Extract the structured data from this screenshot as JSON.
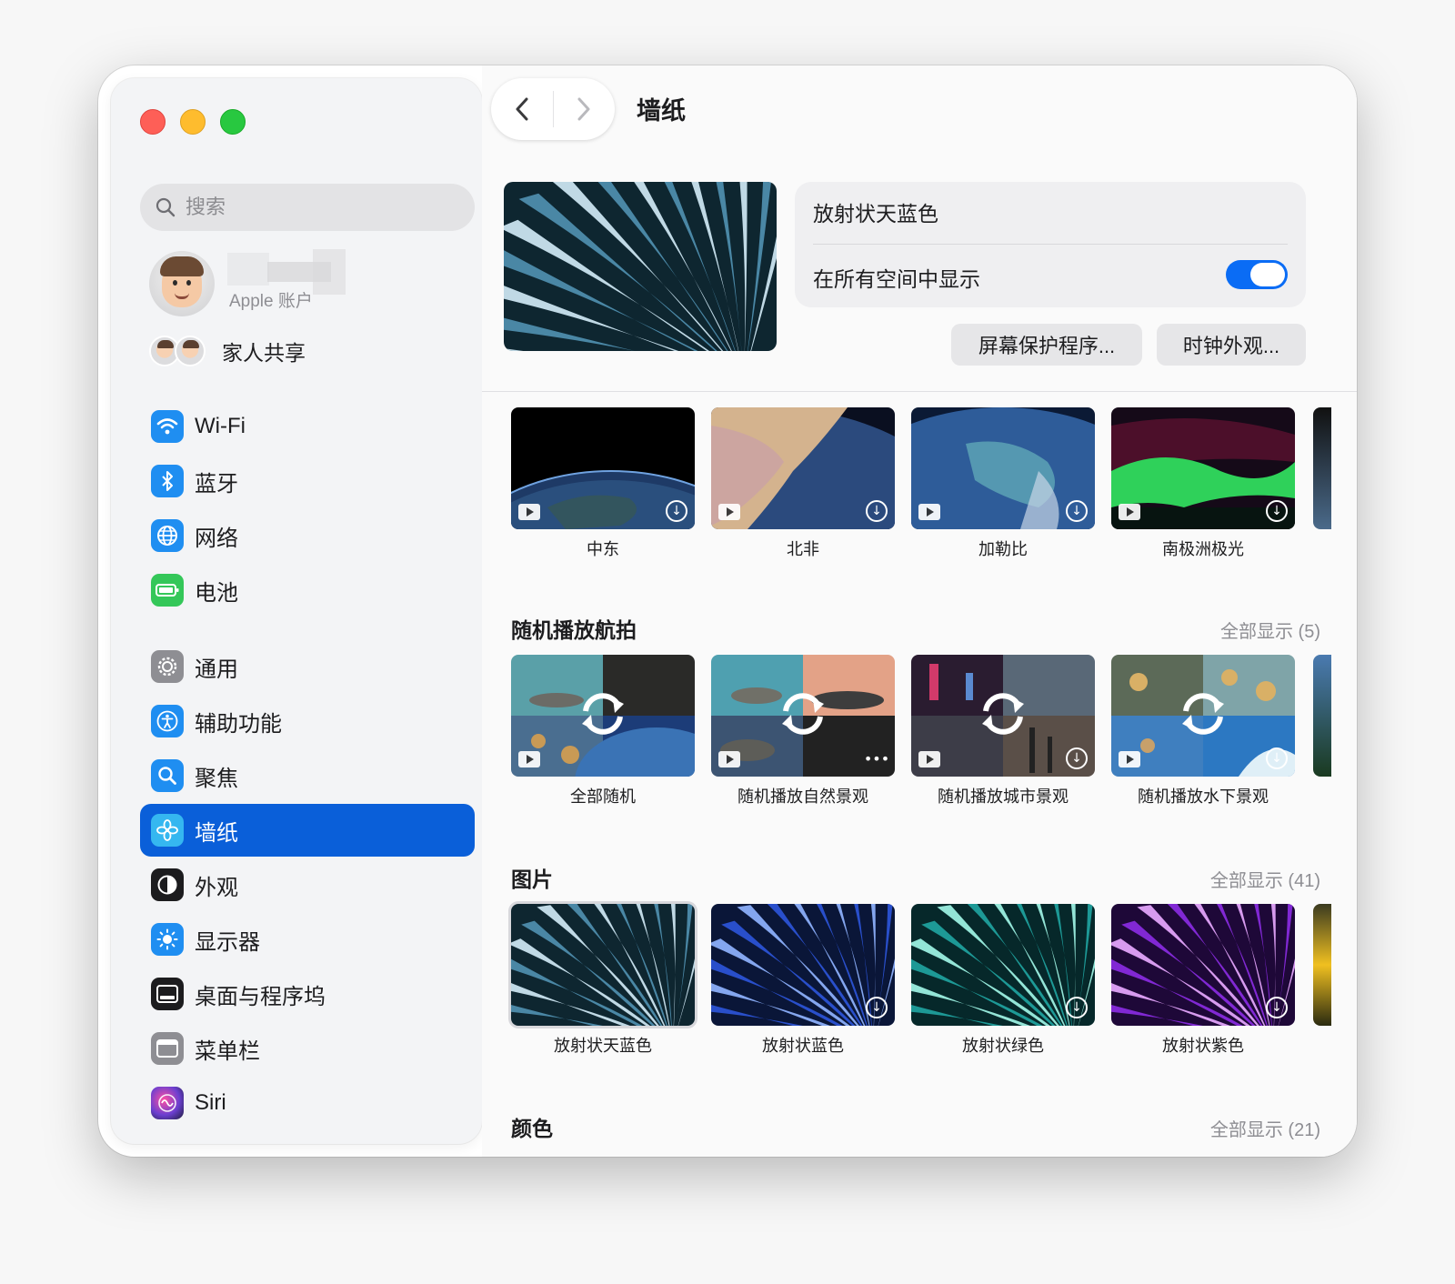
{
  "sidebar": {
    "search_placeholder": "搜索",
    "account_sub": "Apple 账户",
    "family_label": "家人共享",
    "items": [
      {
        "label": "Wi-Fi",
        "icon": "wifi-icon",
        "color": "#1f8ef1"
      },
      {
        "label": "蓝牙",
        "icon": "bluetooth-icon",
        "color": "#1f8ef1"
      },
      {
        "label": "网络",
        "icon": "globe-icon",
        "color": "#1f8ef1"
      },
      {
        "label": "电池",
        "icon": "battery-icon",
        "color": "#34c759"
      },
      {
        "label": "通用",
        "icon": "gear-icon",
        "color": "#8e8e93"
      },
      {
        "label": "辅助功能",
        "icon": "accessibility-icon",
        "color": "#1f8ef1"
      },
      {
        "label": "聚焦",
        "icon": "spotlight-icon",
        "color": "#1f8ef1"
      },
      {
        "label": "墙纸",
        "icon": "wallpaper-icon",
        "color": "#35b7f0"
      },
      {
        "label": "外观",
        "icon": "appearance-icon",
        "color": "#1c1c1e"
      },
      {
        "label": "显示器",
        "icon": "brightness-icon",
        "color": "#1f8ef1"
      },
      {
        "label": "桌面与程序坞",
        "icon": "dock-icon",
        "color": "#1c1c1e"
      },
      {
        "label": "菜单栏",
        "icon": "menubar-icon",
        "color": "#8e8e93"
      },
      {
        "label": "Siri",
        "icon": "siri-icon",
        "color": "#6b3fd0"
      }
    ],
    "active_label": "墙纸"
  },
  "toolbar": {
    "back_glyph": "‹",
    "forward_glyph": "›",
    "title": "墙纸"
  },
  "current": {
    "name": "放射状天蓝色",
    "toggle_label": "在所有空间中显示",
    "toggle_on": true,
    "screensaver_button": "屏幕保护程序...",
    "clock_button": "时钟外观..."
  },
  "aerials": {
    "items": [
      "中东",
      "北非",
      "加勒比",
      "南极洲极光"
    ]
  },
  "shuffle": {
    "title": "随机播放航拍",
    "show_all": "全部显示 (5)",
    "items": [
      "全部随机",
      "随机播放自然景观",
      "随机播放城市景观",
      "随机播放水下景观"
    ]
  },
  "pictures": {
    "title": "图片",
    "show_all": "全部显示 (41)",
    "items": [
      "放射状天蓝色",
      "放射状蓝色",
      "放射状绿色",
      "放射状紫色"
    ]
  },
  "colors": {
    "title": "颜色",
    "show_all": "全部显示 (21)"
  },
  "accent_color": "#0a5fd9"
}
